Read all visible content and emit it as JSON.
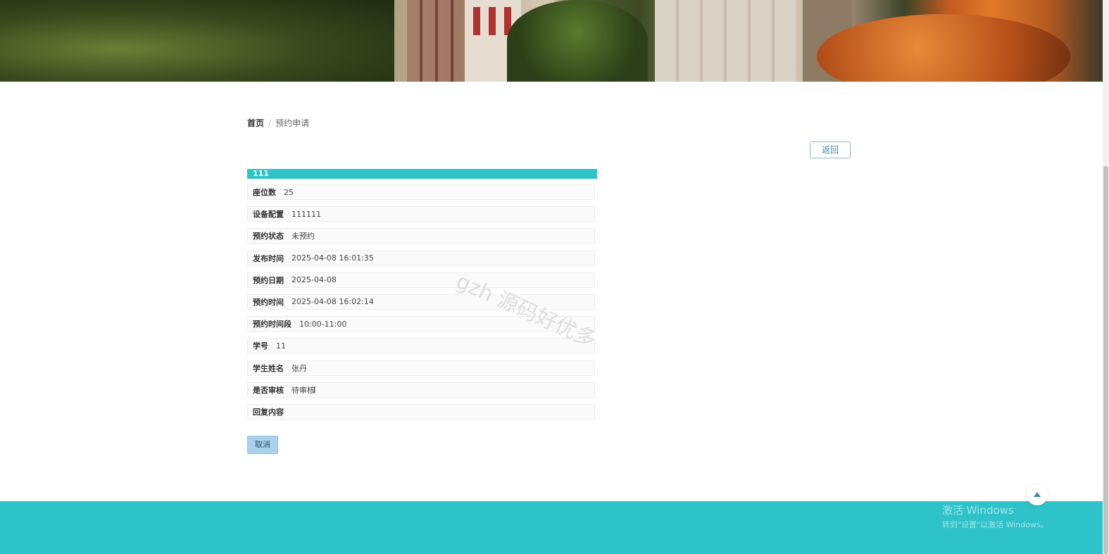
{
  "breadcrumb": {
    "home": "首页",
    "separator": "/",
    "current": "预约申请"
  },
  "back_button": "返回",
  "detail": {
    "title": "111",
    "rows": [
      {
        "label": "座位数",
        "value": "25"
      },
      {
        "label": "设备配置",
        "value": "111111"
      },
      {
        "label": "预约状态",
        "value": "未预约"
      },
      {
        "label": "发布时间",
        "value": "2025-04-08 16:01:35"
      },
      {
        "label": "预约日期",
        "value": "2025-04-08"
      },
      {
        "label": "预约时间",
        "value": "2025-04-08 16:02:14"
      },
      {
        "label": "预约时间段",
        "value": "10:00-11:00"
      },
      {
        "label": "学号",
        "value": "11"
      },
      {
        "label": "学生姓名",
        "value": "张丹"
      },
      {
        "label": "是否审核",
        "value": "待审核"
      },
      {
        "label": "回复内容",
        "value": ""
      }
    ]
  },
  "cancel_button": "取消",
  "watermark": "gzh 源码好优多",
  "windows_activation": {
    "line1": "激活 Windows",
    "line2": "转到\"设置\"以激活 Windows。"
  },
  "colors": {
    "accent": "#2ec3c8",
    "link": "#3a86b8",
    "cancel_bg": "#a9d1ec"
  }
}
